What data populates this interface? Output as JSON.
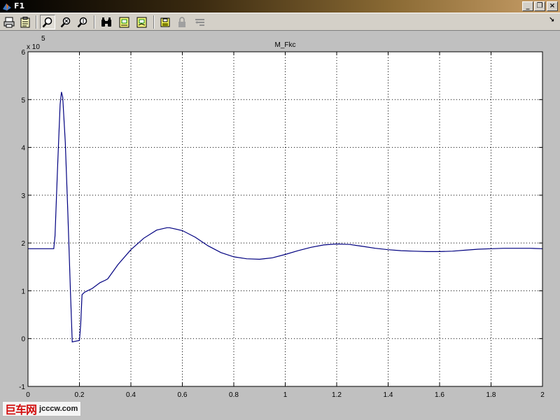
{
  "window": {
    "title": "F1",
    "controls": {
      "minimize": "_",
      "restore": "❐",
      "close": "×"
    }
  },
  "toolbar": {
    "buttons": [
      {
        "name": "print-button",
        "icon": "printer-icon"
      },
      {
        "name": "parameters-button",
        "icon": "clipboard-icon"
      },
      {
        "name": "zoom-button",
        "icon": "zoom-icon",
        "pressed": true
      },
      {
        "name": "zoom-x-button",
        "icon": "zoom-x-icon"
      },
      {
        "name": "zoom-y-button",
        "icon": "zoom-y-icon"
      },
      {
        "name": "autoscale-button",
        "icon": "binoculars-icon"
      },
      {
        "name": "save-axes-button",
        "icon": "save-axes-icon"
      },
      {
        "name": "restore-axes-button",
        "icon": "restore-axes-icon"
      },
      {
        "name": "floating-scope-button",
        "icon": "floppy-icon"
      },
      {
        "name": "lock-axes-button",
        "icon": "lock-icon",
        "disabled": true
      },
      {
        "name": "signal-selection-button",
        "icon": "signal-selection-icon",
        "disabled": true
      }
    ],
    "dock_arrow": "↘"
  },
  "chart_data": {
    "type": "line",
    "title": "M_Fkc",
    "xlabel": "",
    "ylabel": "",
    "exponent_label": "x 10",
    "exponent_power": "5",
    "xlim": [
      0,
      2
    ],
    "ylim": [
      -1,
      6
    ],
    "xticks": [
      "0",
      "0.2",
      "0.4",
      "0.6",
      "0.8",
      "1",
      "1.2",
      "1.4",
      "1.6",
      "1.8",
      "2"
    ],
    "yticks": [
      "-1",
      "0",
      "1",
      "2",
      "3",
      "4",
      "5",
      "6"
    ],
    "grid": true,
    "background": "#ffffff",
    "line_color": "#000080",
    "series": [
      {
        "x": [
          0,
          0.05,
          0.1,
          0.105,
          0.115,
          0.125,
          0.13,
          0.135,
          0.145,
          0.155,
          0.165,
          0.172,
          0.18,
          0.2,
          0.205,
          0.21,
          0.22,
          0.25,
          0.28,
          0.3,
          0.31,
          0.35,
          0.4,
          0.45,
          0.5,
          0.54,
          0.55,
          0.6,
          0.65,
          0.7,
          0.75,
          0.8,
          0.85,
          0.9,
          0.95,
          1.0,
          1.05,
          1.1,
          1.15,
          1.2,
          1.25,
          1.3,
          1.35,
          1.4,
          1.45,
          1.5,
          1.55,
          1.6,
          1.65,
          1.7,
          1.75,
          1.8,
          1.85,
          1.9,
          1.95,
          2.0
        ],
        "y": [
          1.88,
          1.88,
          1.88,
          2.15,
          3.6,
          4.9,
          5.16,
          5.05,
          4.1,
          2.6,
          1.0,
          -0.07,
          -0.06,
          -0.04,
          0.3,
          0.92,
          0.97,
          1.05,
          1.17,
          1.22,
          1.25,
          1.55,
          1.86,
          2.1,
          2.27,
          2.32,
          2.32,
          2.26,
          2.12,
          1.94,
          1.8,
          1.71,
          1.67,
          1.66,
          1.69,
          1.76,
          1.84,
          1.91,
          1.96,
          1.98,
          1.97,
          1.93,
          1.89,
          1.86,
          1.84,
          1.83,
          1.82,
          1.82,
          1.83,
          1.85,
          1.87,
          1.88,
          1.89,
          1.89,
          1.89,
          1.88
        ]
      }
    ]
  },
  "watermark": {
    "text_cn": "巨车网",
    "text_url": "jcccw.com"
  }
}
